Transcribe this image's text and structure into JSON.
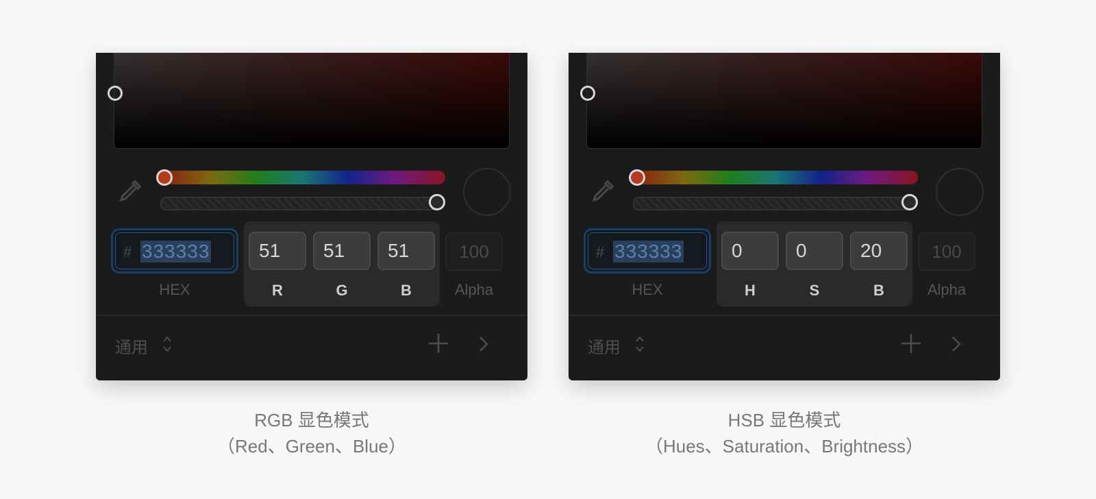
{
  "colors": {
    "page_background": "#f7f7f7",
    "panel_background": "#1b1b1b",
    "hex_focus_border": "#184068",
    "hex_selection": "#2a3f5a"
  },
  "panels": {
    "rgb": {
      "hex": {
        "hash": "#",
        "value": "333333",
        "label": "HEX"
      },
      "channels": [
        {
          "value": "51",
          "label": "R"
        },
        {
          "value": "51",
          "label": "G"
        },
        {
          "value": "51",
          "label": "B"
        }
      ],
      "alpha": {
        "value": "100",
        "label": "Alpha"
      },
      "footer": {
        "select_label": "通用"
      },
      "caption": {
        "title": "RGB 显色模式",
        "subtitle": "（Red、Green、Blue）"
      }
    },
    "hsb": {
      "hex": {
        "hash": "#",
        "value": "333333",
        "label": "HEX"
      },
      "channels": [
        {
          "value": "0",
          "label": "H"
        },
        {
          "value": "0",
          "label": "S"
        },
        {
          "value": "20",
          "label": "B"
        }
      ],
      "alpha": {
        "value": "100",
        "label": "Alpha"
      },
      "footer": {
        "select_label": "通用"
      },
      "caption": {
        "title": "HSB 显色模式",
        "subtitle": "（Hues、Saturation、Brightness）"
      }
    }
  },
  "icons": [
    "eyedropper-icon",
    "updown-chevron-icon",
    "plus-icon",
    "chevron-right-icon"
  ]
}
